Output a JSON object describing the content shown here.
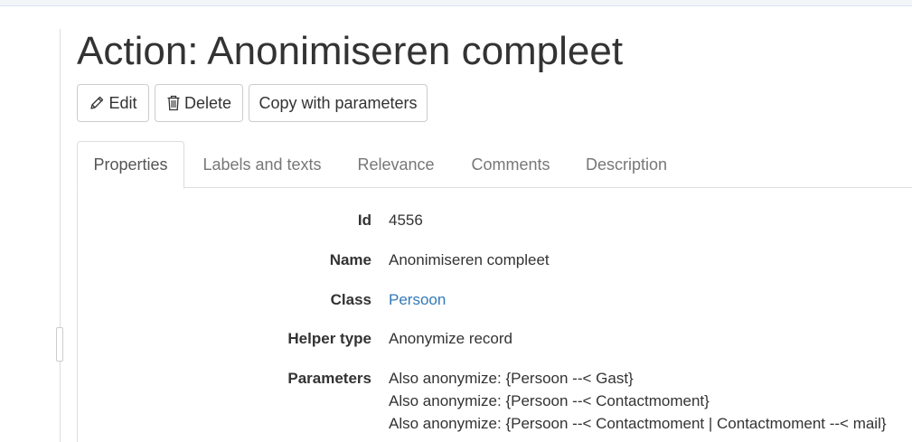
{
  "page": {
    "title": "Action: Anonimiseren compleet"
  },
  "toolbar": {
    "edit_label": "Edit",
    "delete_label": "Delete",
    "copy_label": "Copy with parameters",
    "edit_icon": "pencil-icon",
    "delete_icon": "trash-icon"
  },
  "tabs": [
    {
      "label": "Properties",
      "active": true
    },
    {
      "label": "Labels and texts",
      "active": false
    },
    {
      "label": "Relevance",
      "active": false
    },
    {
      "label": "Comments",
      "active": false
    },
    {
      "label": "Description",
      "active": false
    }
  ],
  "properties": {
    "id": {
      "label": "Id",
      "value": "4556"
    },
    "name": {
      "label": "Name",
      "value": "Anonimiseren compleet"
    },
    "class": {
      "label": "Class",
      "value": "Persoon"
    },
    "helper_type": {
      "label": "Helper type",
      "value": "Anonymize record"
    },
    "parameters": {
      "label": "Parameters",
      "values": [
        "Also anonymize: {Persoon --< Gast}",
        "Also anonymize: {Persoon --< Contactmoment}",
        "Also anonymize: {Persoon --< Contactmoment | Contactmoment --< mail}"
      ]
    }
  },
  "colors": {
    "link": "#337ab7",
    "text": "#333333",
    "tab_inactive": "#777777",
    "border": "#dddddd"
  }
}
